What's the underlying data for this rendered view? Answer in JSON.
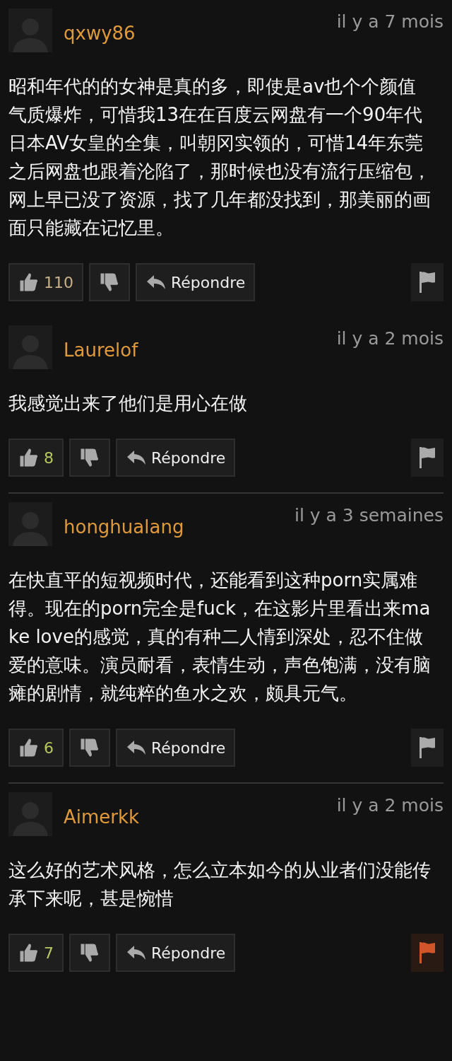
{
  "comments": [
    {
      "user": "qxwy86",
      "time": "il y a 7 mois",
      "text": "昭和年代的的女神是真的多，即使是av也个个颜值气质爆炸，可惜我13在在百度云网盘有一个90年代日本AV女皇的全集，叫朝冈实领的，可惜14年东莞之后网盘也跟着沦陷了，那时候也没有流行压缩包，网上早已没了资源，找了几年都没找到，那美丽的画面只能藏在记忆里。",
      "likes": "110",
      "color": "#c8b088",
      "reply": "Répondre",
      "flag_active": false,
      "divider_above": false
    },
    {
      "user": "Laurelof",
      "time": "il y a 2 mois",
      "text": "我感觉出来了他们是用心在做",
      "likes": "8",
      "color": "#b8c860",
      "reply": "Répondre",
      "flag_active": false,
      "divider_above": false
    },
    {
      "user": "honghualang",
      "time": "il y a 3 semaines",
      "text": "在快直平的短视频时代，还能看到这种porn实属难得。现在的porn完全是fuck，在这影片里看出来make love的感觉，真的有种二人情到深处，忍不住做爱的意味。演员耐看，表情生动，声色饱满，没有脑瘫的剧情，就纯粹的鱼水之欢，颇具元气。",
      "likes": "6",
      "color": "#b8c860",
      "reply": "Répondre",
      "flag_active": false,
      "divider_above": true
    },
    {
      "user": "Aimerkk",
      "time": "il y a 2 mois",
      "text": "这么好的艺术风格，怎么立本如今的从业者们没能传承下来呢，甚是惋惜",
      "likes": "7",
      "color": "#b8c860",
      "reply": "Répondre",
      "flag_active": true,
      "divider_above": true
    }
  ]
}
